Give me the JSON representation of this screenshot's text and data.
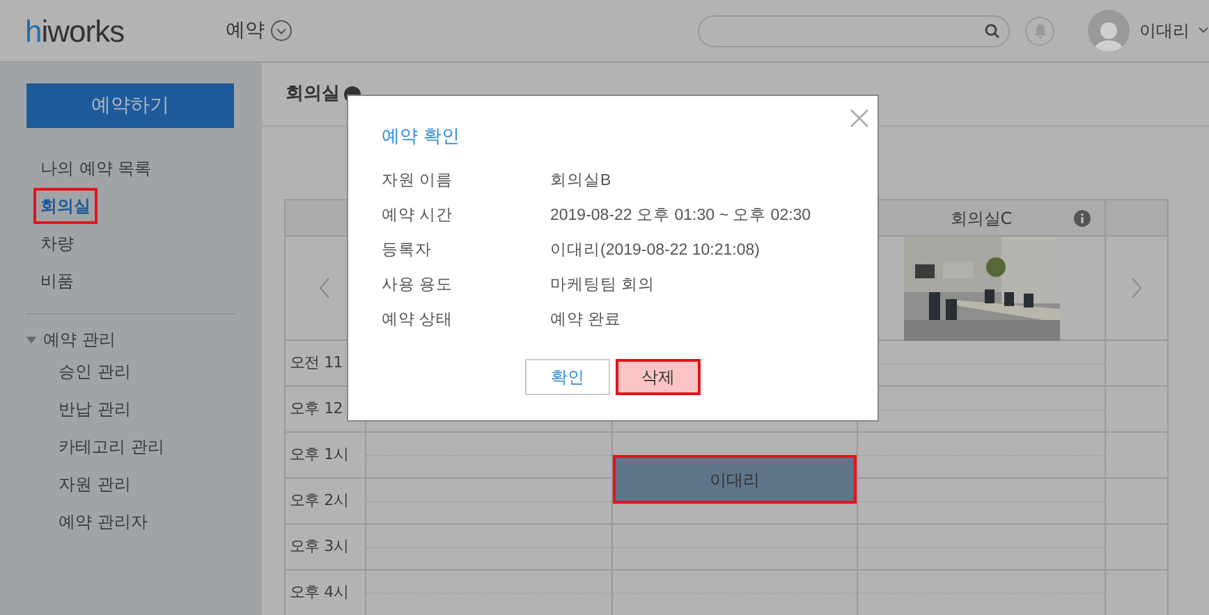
{
  "topbar": {
    "logo": "hiworks",
    "menu": "예약",
    "user": "이대리"
  },
  "sidebar": {
    "reserve_button": "예약하기",
    "items": [
      {
        "label": "나의 예약 목록",
        "selected": false,
        "highlighted": false
      },
      {
        "label": "회의실",
        "selected": true,
        "highlighted": true
      },
      {
        "label": "차량",
        "selected": false,
        "highlighted": false
      },
      {
        "label": "비품",
        "selected": false,
        "highlighted": false
      }
    ],
    "admin": {
      "label": "예약 관리",
      "expanded": true,
      "children": [
        {
          "label": "승인 관리"
        },
        {
          "label": "반납 관리"
        },
        {
          "label": "카테고리 관리"
        },
        {
          "label": "자원 관리"
        },
        {
          "label": "예약 관리자"
        }
      ]
    }
  },
  "content": {
    "title": "회의실",
    "room_header": "회의실C",
    "time_rows": [
      "오전 11",
      "오후 12",
      "오후 1시",
      "오후 2시",
      "오후 3시",
      "오후 4시"
    ],
    "event": {
      "label": "이대리",
      "highlighted": true
    }
  },
  "dialog": {
    "title": "예약 확인",
    "fields": [
      {
        "label": "자원 이름",
        "value": "회의실B"
      },
      {
        "label": "예약 시간",
        "value": "2019-08-22 오후 01:30 ~ 오후 02:30"
      },
      {
        "label": "등록자",
        "value": "이대리(2019-08-22 10:21:08)"
      },
      {
        "label": "사용 용도",
        "value": "마케팅팀 회의"
      },
      {
        "label": "예약 상태",
        "value": "예약 완료"
      }
    ],
    "buttons": [
      {
        "label": "확인",
        "kind": "confirm",
        "highlighted": false
      },
      {
        "label": "삭제",
        "kind": "delete",
        "highlighted": true
      }
    ]
  }
}
